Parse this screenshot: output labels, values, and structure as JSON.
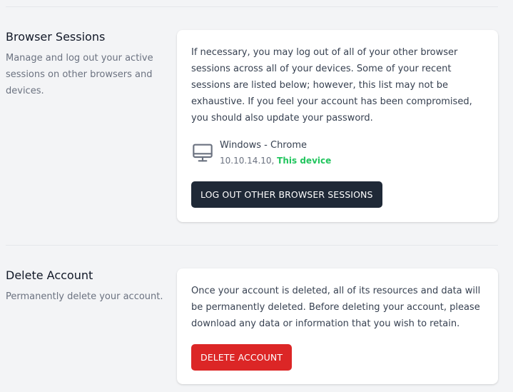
{
  "browser_sessions": {
    "title": "Browser Sessions",
    "description": "Manage and log out your active sessions on other browsers and devices.",
    "body": "If necessary, you may log out of all of your other browser sessions across all of your devices. Some of your recent sessions are listed below; however, this list may not be exhaustive. If you feel your account has been compromised, you should also update your password.",
    "sessions": [
      {
        "device_icon": "monitor-icon",
        "platform": "Windows - Chrome",
        "ip": "10.10.14.10",
        "separator": ", ",
        "current_label": "This device"
      }
    ],
    "logout_button_label": "LOG OUT OTHER BROWSER SESSIONS"
  },
  "delete_account": {
    "title": "Delete Account",
    "description": "Permanently delete your account.",
    "body": "Once your account is deleted, all of its resources and data will be permanently deleted. Before deleting your account, please download any data or information that you wish to retain.",
    "delete_button_label": "DELETE ACCOUNT"
  },
  "colors": {
    "background": "#f3f4f6",
    "card": "#ffffff",
    "dark_button": "#1f2937",
    "danger_button": "#dc2626",
    "current_device": "#22c55e",
    "muted_text": "#6b7280"
  }
}
